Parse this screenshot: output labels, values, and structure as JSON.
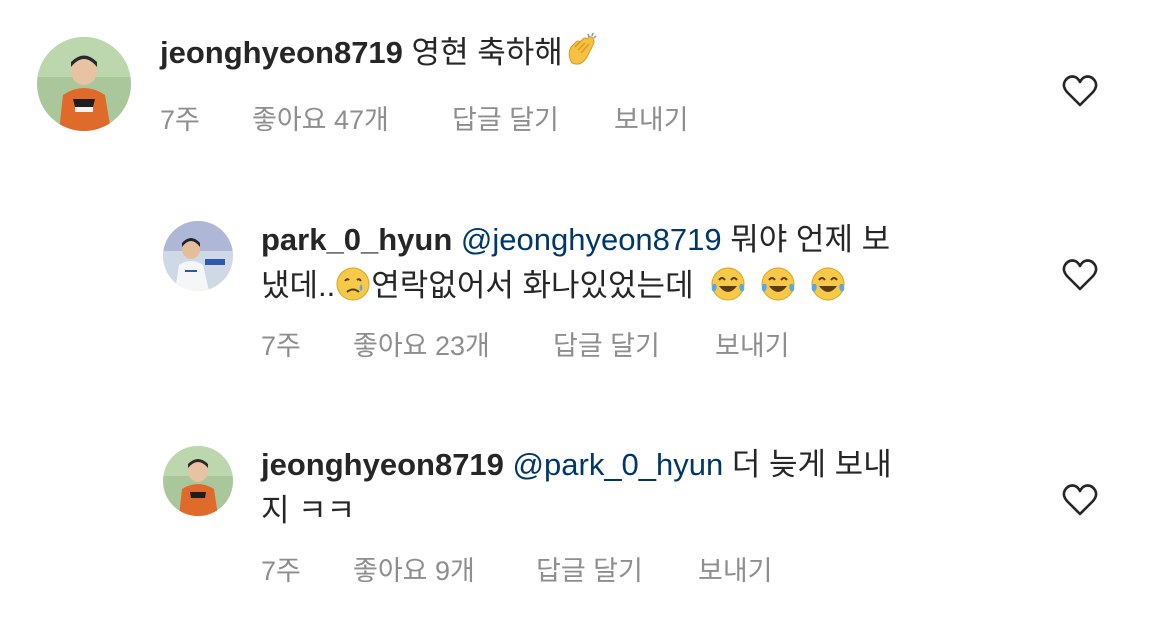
{
  "comments": [
    {
      "username": "jeonghyeon8719",
      "mention": "",
      "text": "영현 축하해",
      "emoji_trailing": [
        "clapping-hands"
      ],
      "time": "7주",
      "likes": "좋아요 47개",
      "reply": "답글 달기",
      "send": "보내기"
    },
    {
      "username": "park_0_hyun",
      "mention": "@jeonghyeon8719",
      "text_part1": "뭐야 언제 보",
      "text_part2": "냈데..",
      "text_part3": "연락없어서 화나있었는데",
      "emoji_mid": "crying-face",
      "emoji_trailing": [
        "tears-of-joy",
        "tears-of-joy",
        "tears-of-joy"
      ],
      "time": "7주",
      "likes": "좋아요 23개",
      "reply": "답글 달기",
      "send": "보내기"
    },
    {
      "username": "jeonghyeon8719",
      "mention": "@park_0_hyun",
      "text_part1": "더 늦게 보내",
      "text_part2": "지 ㅋㅋ",
      "time": "7주",
      "likes": "좋아요 9개",
      "reply": "답글 달기",
      "send": "보내기"
    }
  ],
  "colors": {
    "text": "#262626",
    "secondary": "#8e8e8e",
    "mention": "#00376b",
    "background": "#ffffff"
  }
}
